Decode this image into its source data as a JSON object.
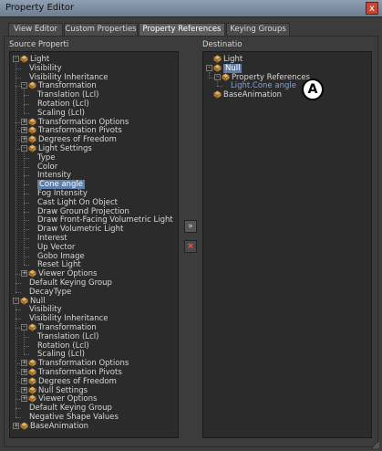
{
  "window": {
    "title": "Property Editor",
    "close_label": "x"
  },
  "tabs": [
    "View Editor",
    "Custom Properties",
    "Property References",
    "Keying Groups"
  ],
  "active_tab": "Property References",
  "source": {
    "label": "Source Properti",
    "rows": [
      {
        "text": "Light",
        "level": 0,
        "expand": "-",
        "icon": true
      },
      {
        "text": "Visibility",
        "level": 1
      },
      {
        "text": "Visibility Inheritance",
        "level": 1
      },
      {
        "text": "Transformation",
        "level": 1,
        "expand": "-",
        "icon": true
      },
      {
        "text": "Translation (Lcl)",
        "level": 2
      },
      {
        "text": "Rotation (Lcl)",
        "level": 2
      },
      {
        "text": "Scaling (Lcl)",
        "level": 2
      },
      {
        "text": "Transformation Options",
        "level": 1,
        "expand": "+",
        "icon": true
      },
      {
        "text": "Transformation Pivots",
        "level": 1,
        "expand": "+",
        "icon": true
      },
      {
        "text": "Degrees of Freedom",
        "level": 1,
        "expand": "+",
        "icon": true
      },
      {
        "text": "Light Settings",
        "level": 1,
        "expand": "-",
        "icon": true
      },
      {
        "text": "Type",
        "level": 2
      },
      {
        "text": "Color",
        "level": 2
      },
      {
        "text": "Intensity",
        "level": 2
      },
      {
        "text": "Cone angle",
        "level": 2,
        "selected": true
      },
      {
        "text": "Fog Intensity",
        "level": 2
      },
      {
        "text": "Cast Light On Object",
        "level": 2
      },
      {
        "text": "Draw Ground Projection",
        "level": 2
      },
      {
        "text": "Draw Front-Facing Volumetric Light",
        "level": 2
      },
      {
        "text": "Draw Volumetric Light",
        "level": 2
      },
      {
        "text": "Interest",
        "level": 2
      },
      {
        "text": "Up Vector",
        "level": 2
      },
      {
        "text": "Gobo Image",
        "level": 2
      },
      {
        "text": "Reset Light",
        "level": 2
      },
      {
        "text": "Viewer Options",
        "level": 1,
        "expand": "+",
        "icon": true
      },
      {
        "text": "Default Keying Group",
        "level": 1
      },
      {
        "text": "DecayType",
        "level": 1
      },
      {
        "text": "Null",
        "level": 0,
        "expand": "-",
        "icon": true
      },
      {
        "text": "Visibility",
        "level": 1
      },
      {
        "text": "Visibility Inheritance",
        "level": 1
      },
      {
        "text": "Transformation",
        "level": 1,
        "expand": "-",
        "icon": true
      },
      {
        "text": "Translation (Lcl)",
        "level": 2
      },
      {
        "text": "Rotation (Lcl)",
        "level": 2
      },
      {
        "text": "Scaling (Lcl)",
        "level": 2
      },
      {
        "text": "Transformation Options",
        "level": 1,
        "expand": "+",
        "icon": true
      },
      {
        "text": "Transformation Pivots",
        "level": 1,
        "expand": "+",
        "icon": true
      },
      {
        "text": "Degrees of Freedom",
        "level": 1,
        "expand": "+",
        "icon": true
      },
      {
        "text": "Null Settings",
        "level": 1,
        "expand": "+",
        "icon": true
      },
      {
        "text": "Viewer Options",
        "level": 1,
        "expand": "+",
        "icon": true
      },
      {
        "text": "Default Keying Group",
        "level": 1
      },
      {
        "text": "Negative Shape Values",
        "level": 1
      },
      {
        "text": "BaseAnimation",
        "level": 0,
        "expand": "+",
        "icon": true
      }
    ]
  },
  "destination": {
    "label": "Destinatio",
    "rows": [
      {
        "text": "Light",
        "level": 0,
        "icon": true
      },
      {
        "text": "Null",
        "level": 0,
        "expand": "-",
        "icon": true,
        "selected": true
      },
      {
        "text": "Property References",
        "level": 1,
        "expand": "-",
        "icon": true
      },
      {
        "text": "Light.Cone angle",
        "level": 2,
        "binding": true
      },
      {
        "text": "BaseAnimation",
        "level": 0,
        "icon": true
      }
    ]
  },
  "middle_buttons": {
    "add_label": "»",
    "remove_label": "×"
  },
  "callout_label": "A",
  "colors": {
    "selection": "#5f7fa8",
    "binding_text": "#7fa6d8",
    "remove_red": "#c8342a"
  }
}
